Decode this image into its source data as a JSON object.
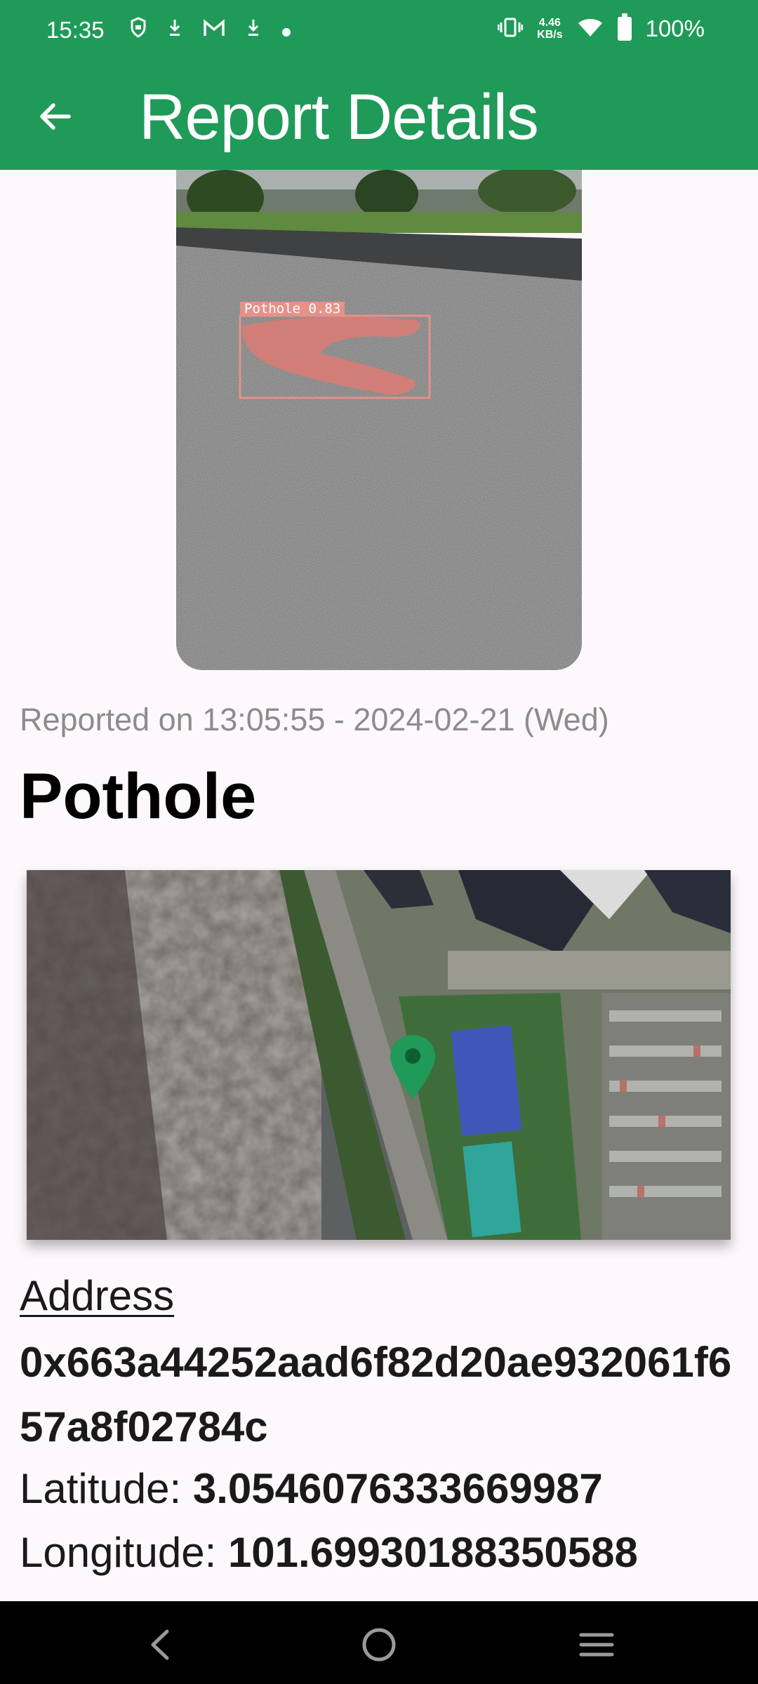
{
  "status_bar": {
    "time": "15:35",
    "notification_icons": [
      "shield-icon",
      "download-icon",
      "gmail-icon",
      "download-icon",
      "dot-icon"
    ],
    "net_speed_value": "4.46",
    "net_speed_unit": "KB/s",
    "battery_text": "100%"
  },
  "app_bar": {
    "title": "Report Details",
    "back_icon": "arrow-back-icon",
    "background_color": "#1f9a58"
  },
  "photo": {
    "detection_label": "Pothole 0.83",
    "detection_color": "#e79189"
  },
  "report": {
    "reported_on": "Reported on 13:05:55 - 2024-02-21 (Wed)",
    "type": "Pothole"
  },
  "map": {
    "marker_icon": "location-pin-icon",
    "marker_color": "#1f9a58"
  },
  "details": {
    "address_label": "Address",
    "address_value": "0x663a44252aad6f82d20ae932061f657a8f02784c",
    "latitude_label": "Latitude: ",
    "latitude_value": "3.0546076333669987",
    "longitude_label": "Longitude: ",
    "longitude_value": "101.69930188350588"
  },
  "nav_bar": {
    "back_icon": "nav-back-icon",
    "home_icon": "nav-home-icon",
    "recents_icon": "nav-recents-icon"
  }
}
